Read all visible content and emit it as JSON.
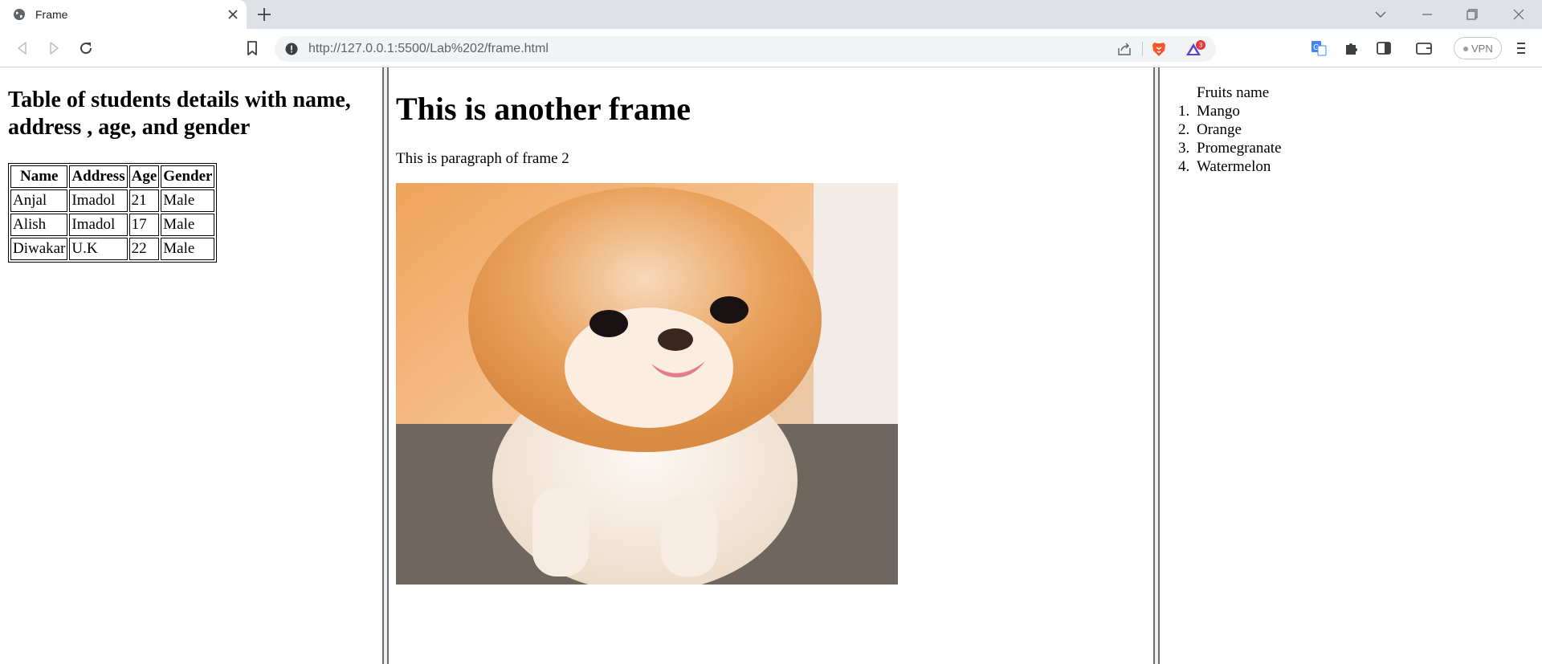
{
  "browser": {
    "tab_title": "Frame",
    "url": "http://127.0.0.1:5500/Lab%202/frame.html",
    "rewards_badge": "3",
    "vpn_label": "VPN",
    "icons": [
      "globe-icon",
      "close-icon",
      "plus-icon",
      "chevron-down-icon",
      "minimize-icon",
      "restore-icon",
      "back-icon",
      "forward-icon",
      "reload-icon",
      "bookmark-icon",
      "info-icon",
      "share-icon",
      "brave-lion-icon",
      "brave-rewards-icon",
      "translate-icon",
      "puzzle-icon",
      "sidebar-icon",
      "wallet-icon",
      "menu-icon"
    ]
  },
  "frame_left": {
    "heading": "Table of students details with name, address , age, and gender",
    "table": {
      "headers": [
        "Name",
        "Address",
        "Age",
        "Gender"
      ],
      "rows": [
        [
          "Anjal",
          "Imadol",
          "21",
          "Male"
        ],
        [
          "Alish",
          "Imadol",
          "17",
          "Male"
        ],
        [
          "Diwakar",
          "U.K",
          "22",
          "Male"
        ]
      ]
    }
  },
  "frame_mid": {
    "heading": "This is another frame",
    "paragraph": "This is paragraph of frame 2",
    "image_subject": "pomeranian puppy"
  },
  "frame_right": {
    "list_title": "Fruits name",
    "fruits": [
      "Mango",
      "Orange",
      "Promegranate",
      "Watermelon"
    ]
  }
}
